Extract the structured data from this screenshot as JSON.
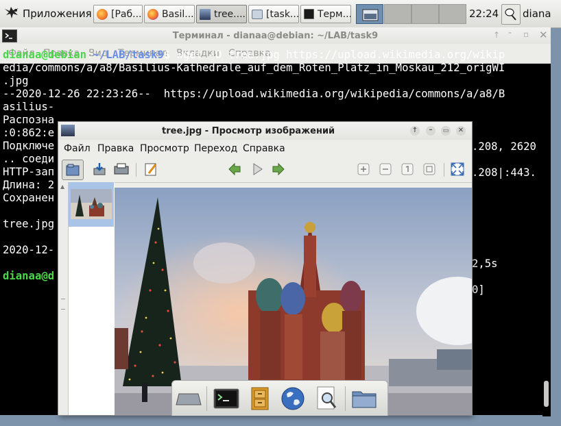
{
  "panel": {
    "app_menu_label": "Приложения",
    "tasks": [
      {
        "label": "[Раб..."
      },
      {
        "label": "Basil..."
      },
      {
        "label": "tree...."
      },
      {
        "label": "[task..."
      },
      {
        "label": "Терм..."
      }
    ],
    "clock": "22:24",
    "user": "diana"
  },
  "terminal": {
    "title": "Терминал - dianaa@debian: ~/LAB/task9",
    "menu": [
      "Файл",
      "Правка",
      "Вид",
      "Терминал",
      "Вкладки",
      "Справка"
    ],
    "prompt_user": "dianaa@debian",
    "prompt_sep": ":",
    "prompt_path": "~/LAB/task9",
    "prompt_end": "$ wget -O tree.jpg https://upload.wikimedia.org/wikip",
    "line2": "edia/commons/a/a8/Basilius-Kathedrale_auf_dem_Roten_Platz_in_Moskau_212_origWI",
    "line3": ".jpg",
    "line4": "--2020-12-26 22:23:26--  https://upload.wikimedia.org/wikipedia/commons/a/a8/B",
    "line5": "asilius-",
    "line6": "Распозна",
    "line6b": ".208, 2620",
    "line7": ":0:862:e",
    "line8": "Подключе",
    "line8b": ".208|:443.",
    "line9": ".. соеди",
    "line10": "HTTP-зап",
    "line11": "Длина: 2",
    "line12": "Сохранен",
    "line14": "tree.jpg",
    "line14b": "2,5s",
    "line16": "2020-12-",
    "line16b": "0]",
    "line18_user": "dianaa@d"
  },
  "viewer": {
    "title": "tree.jpg - Просмотр изображений",
    "menu": [
      "Файл",
      "Правка",
      "Просмотр",
      "Переход",
      "Справка"
    ]
  },
  "colors": {
    "prompt_green": "#4cd64c",
    "path_blue": "#6a8fe8",
    "selection_blue": "#a9c4e6"
  }
}
